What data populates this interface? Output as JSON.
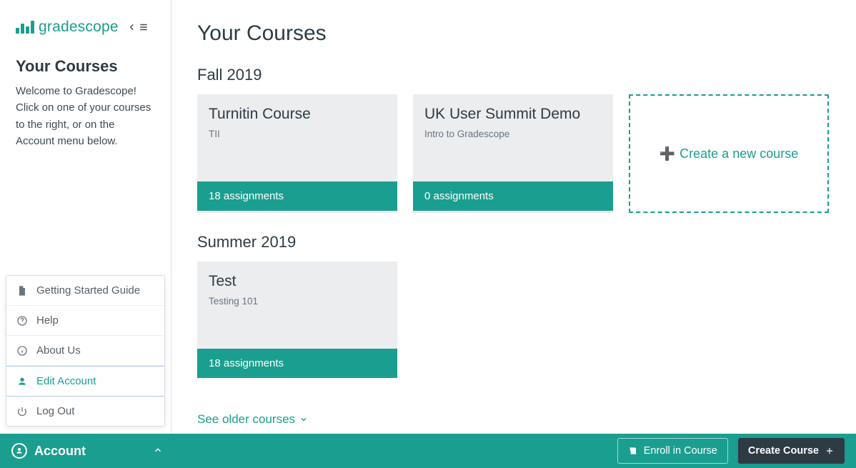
{
  "brand": {
    "name": "gradescope"
  },
  "sidebar": {
    "title": "Your Courses",
    "description": "Welcome to Gradescope! Click on one of your courses to the right, or on the Account menu below."
  },
  "account_menu": {
    "items": [
      {
        "label": "Getting Started Guide",
        "icon": "file-icon"
      },
      {
        "label": "Help",
        "icon": "help-icon"
      },
      {
        "label": "About Us",
        "icon": "info-icon"
      },
      {
        "label": "Edit Account",
        "icon": "user-icon",
        "selected": true
      },
      {
        "label": "Log Out",
        "icon": "power-icon"
      }
    ],
    "toggle_label": "Account"
  },
  "main": {
    "page_title": "Your Courses",
    "new_course_label": "Create a new course",
    "older_courses_label": "See older courses",
    "terms": [
      {
        "name": "Fall 2019",
        "courses": [
          {
            "title": "Turnitin Course",
            "subtitle": "TII",
            "assignments_label": "18 assignments"
          },
          {
            "title": "UK User Summit Demo",
            "subtitle": "Intro to Gradescope",
            "assignments_label": "0 assignments"
          }
        ],
        "show_new_course_card": true
      },
      {
        "name": "Summer 2019",
        "courses": [
          {
            "title": "Test",
            "subtitle": "Testing 101",
            "assignments_label": "18 assignments"
          }
        ],
        "show_new_course_card": false
      }
    ]
  },
  "bottom_bar": {
    "enroll_label": "Enroll in Course",
    "create_label": "Create Course"
  },
  "colors": {
    "accent": "#1a9e8f",
    "dark": "#2e3b44"
  }
}
